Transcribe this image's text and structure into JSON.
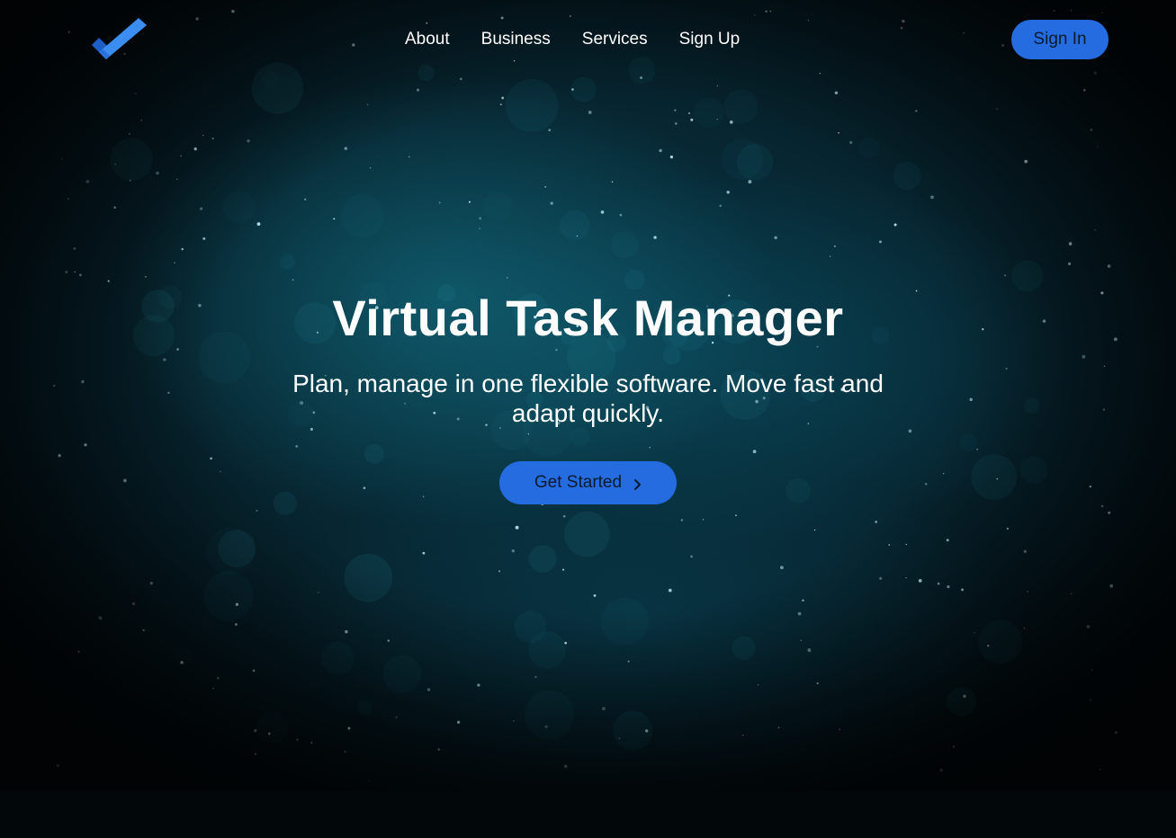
{
  "nav": {
    "links": [
      "About",
      "Business",
      "Services",
      "Sign Up"
    ],
    "signin_label": "Sign In"
  },
  "hero": {
    "title": "Virtual Task Manager",
    "subtitle": "Plan, manage in one flexible software. Move fast and adapt quickly.",
    "cta_label": "Get Started",
    "cta_icon": "chevron-right-icon"
  },
  "colors": {
    "accent": "#256ce0",
    "background": "#02080a",
    "hero_tint": "#0a3a4a",
    "logo_light": "#3b8ef0",
    "logo_dark": "#1d5fc7"
  },
  "logo_icon": "checkmark-logo-icon"
}
